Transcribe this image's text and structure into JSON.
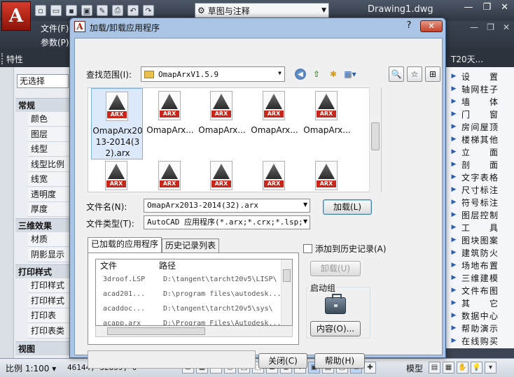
{
  "app": {
    "title": "Drawing1.dwg",
    "logo_letter": "A",
    "workspace": "草图与注释",
    "menu_file": "文件(F)",
    "menu_param": "参数(P)",
    "properties_title": "特性",
    "t20_title": "T20天..."
  },
  "properties": {
    "selection": "无选择",
    "sections": [
      {
        "title": "常规",
        "rows": [
          "颜色",
          "图层",
          "线型",
          "线型比例",
          "线宽",
          "透明度",
          "厚度"
        ]
      },
      {
        "title": "三维效果",
        "rows": [
          "材质",
          "阴影显示"
        ]
      },
      {
        "title": "打印样式",
        "rows": [
          "打印样式",
          "打印样式表",
          "打印表附...",
          "打印表类型"
        ]
      },
      {
        "title": "视图",
        "rows": []
      }
    ]
  },
  "t20_menu": [
    "设　置",
    "轴网柱子",
    "墙　体",
    "门　窗",
    "房间屋顶",
    "楼梯其他",
    "立　面",
    "剖　面",
    "文字表格",
    "尺寸标注",
    "符号标注",
    "图层控制",
    "工　具",
    "图块图案",
    "建筑防火",
    "场地布置",
    "三维建模",
    "文件布图",
    "其　它",
    "数据中心",
    "帮助演示",
    "在线购买"
  ],
  "statusbar": {
    "scale": "比例 1:100 ▾",
    "coords": "46144, 32859, 0",
    "model": "模型"
  },
  "dialog": {
    "title": "加载/卸载应用程序",
    "icon_letter": "A",
    "help": "?",
    "close": "✕",
    "lookin_label": "查找范围(I):",
    "lookin_value": "OmapArxV1.5.9",
    "files_row1": [
      {
        "name": "OmapArx2013-2014(32).arx",
        "selected": true
      },
      {
        "name": "OmapArx...",
        "selected": false
      },
      {
        "name": "OmapArx...",
        "selected": false
      },
      {
        "name": "OmapArx...",
        "selected": false
      },
      {
        "name": "OmapArx...",
        "selected": false
      }
    ],
    "files_row2_count": 5,
    "arx_badge": "ARX",
    "filename_label": "文件名(N):",
    "filename_value": "OmapArx2013-2014(32).arx",
    "filetype_label": "文件类型(T):",
    "filetype_value": "AutoCAD 应用程序(*.arx;*.crx;*.lsp;*",
    "load_button": "加载(L)",
    "tabs": [
      "已加载的应用程序",
      "历史记录列表"
    ],
    "add_history_label": "添加到历史记录(A)",
    "table_headers": [
      "文件",
      "路径"
    ],
    "table_rows": [
      [
        "3droof.LSP",
        "D:\\tangent\\tarcht20v5\\LISP\\"
      ],
      [
        "acad201...",
        "D:\\program files\\autodesk..."
      ],
      [
        "acaddoc...",
        "D:\\tangent\\tarcht20v5\\sys\\"
      ],
      [
        "acapp.arx",
        "D:\\Program Files\\Autodesk..."
      ]
    ],
    "unload_button": "卸载(U)",
    "startup_label": "启动组",
    "contents_button": "内容(O)...",
    "close_button": "关闭(C)",
    "help_button": "帮助(H)"
  }
}
